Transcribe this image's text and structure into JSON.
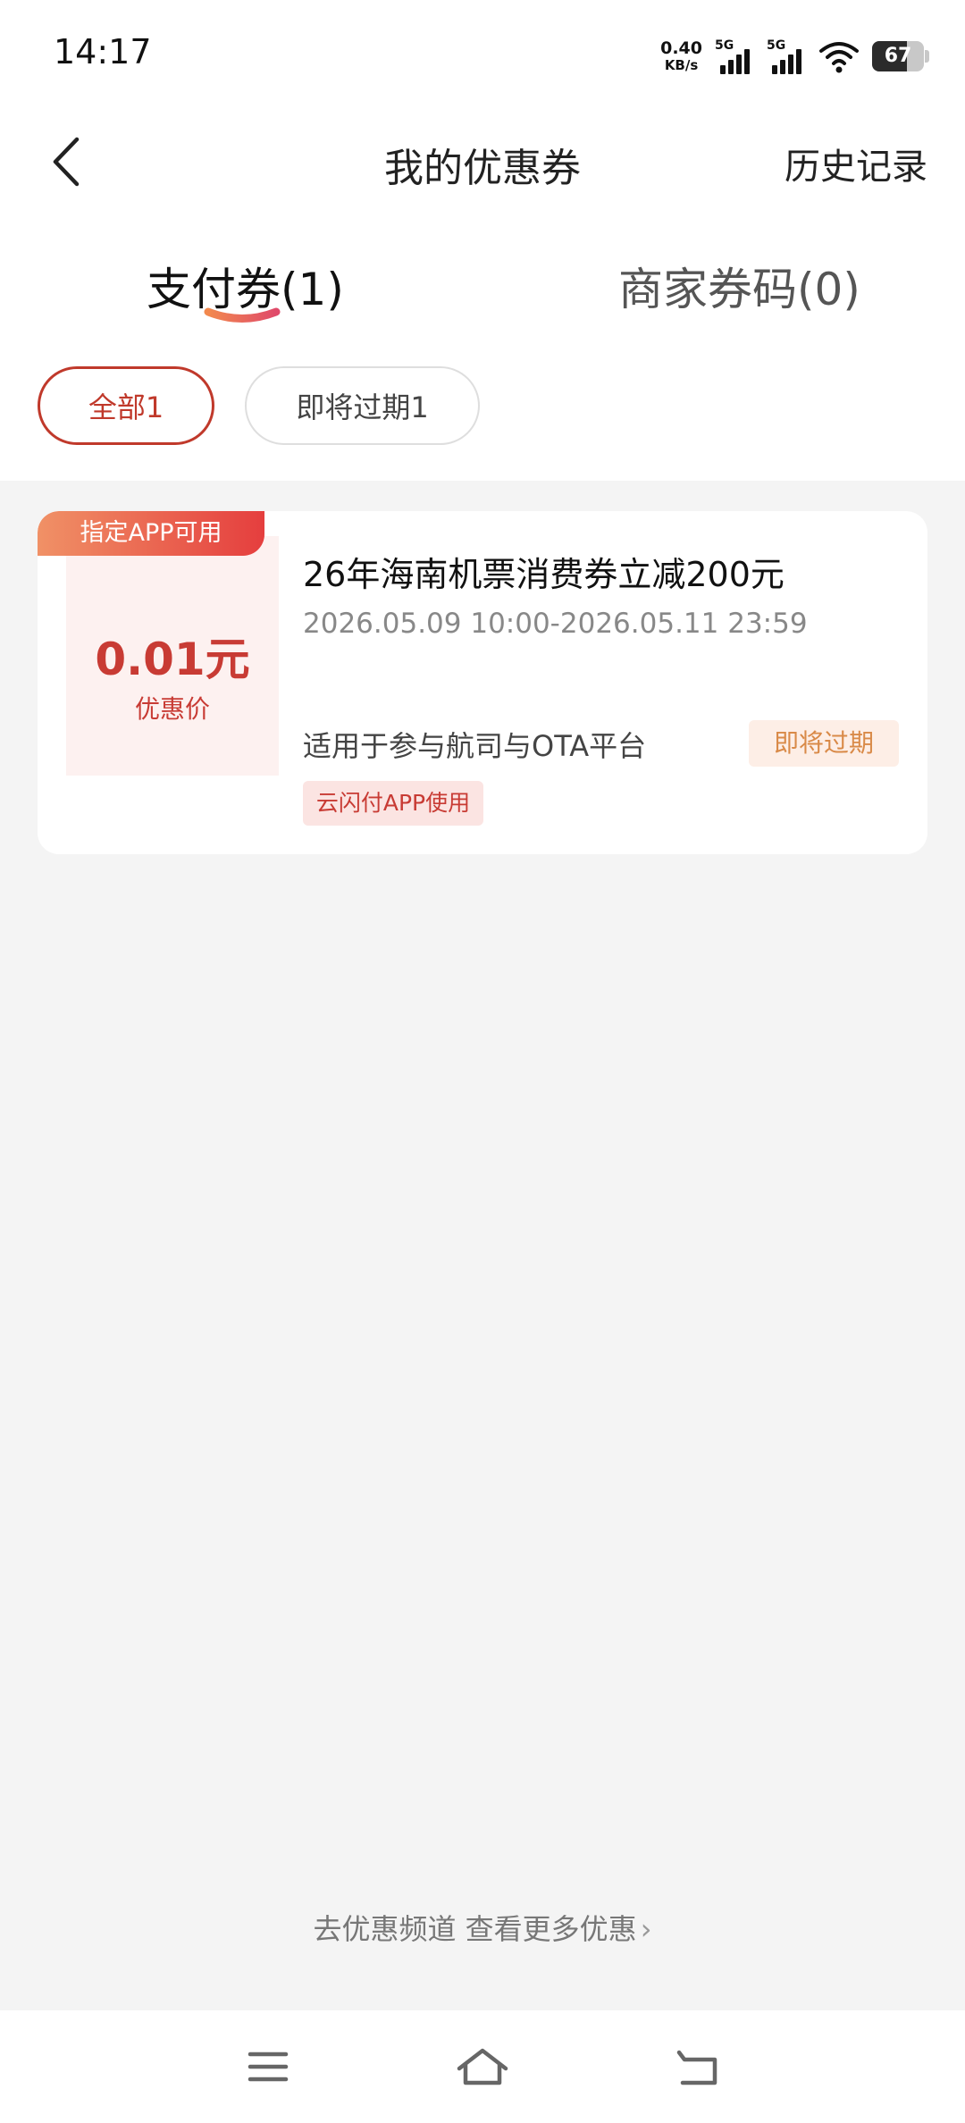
{
  "status_bar": {
    "time": "14:17",
    "net_speed_value": "0.40",
    "net_speed_unit": "KB/s",
    "signal_1": "5G",
    "signal_2": "5G",
    "battery": "67",
    "icons": [
      "wifi-icon",
      "signal-icon",
      "battery-icon"
    ]
  },
  "header": {
    "back_icon": "chevron-left-icon",
    "title": "我的优惠券",
    "history": "历史记录"
  },
  "tabs": [
    {
      "label": "支付券(1)",
      "active": true
    },
    {
      "label": "商家券码(0)",
      "active": false
    }
  ],
  "filters": [
    {
      "label": "全部1",
      "active": true
    },
    {
      "label": "即将过期1",
      "active": false
    }
  ],
  "coupon": {
    "badge": "指定APP可用",
    "price": "0.01元",
    "price_label": "优惠价",
    "title": "26年海南机票消费券立减200元",
    "validity": "2026.05.09 10:00-2026.05.11 23:59",
    "scope": "适用于参与航司与OTA平台",
    "status": "即将过期",
    "app_tag": "云闪付APP使用"
  },
  "footer": {
    "more_link": "去优惠频道 查看更多优惠",
    "more_icon": "chevron-right-icon"
  },
  "system_nav": [
    "menu-icon",
    "home-icon",
    "back-icon"
  ],
  "colors": {
    "accent_red": "#c83b34",
    "warning_orange": "#d98a48",
    "background": "#f4f4f4"
  }
}
